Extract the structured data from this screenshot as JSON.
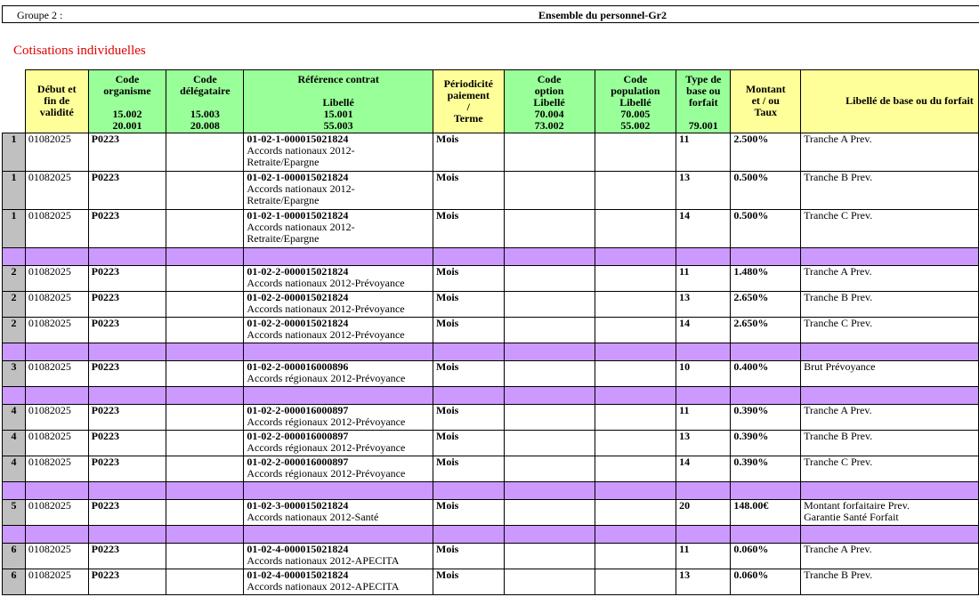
{
  "group": {
    "label": "Groupe 2 :",
    "value": "Ensemble du personnel-Gr2"
  },
  "section_title": "Cotisations individuelles",
  "headers": {
    "debut": "Début et\nfin de\nvalidité",
    "organisme": "Code\norganisme\n\n15.002\n20.001",
    "delegataire": "Code\ndélégataire\n\n15.003\n20.008",
    "reference": "Référence contrat\n\nLibellé\n15.001\n55.003",
    "periodicite": "Périodicité\npaiement\n/\nTerme",
    "option": "Code\noption\nLibellé\n70.004\n73.002",
    "population": "Code\npopulation\nLibellé\n70.005\n55.002",
    "type": "Type de\nbase ou\nforfait\n\n79.001",
    "montant": "Montant\net / ou\nTaux",
    "libelle": "Libellé de base ou du forfait"
  },
  "colors": {
    "yellow": "#ffff99",
    "green": "#99ff99",
    "separator": "#cc99ff",
    "index": "#c0c0c0",
    "section": "#e00000"
  },
  "rows": [
    {
      "idx": "1",
      "date": "01082025",
      "org": "P0223",
      "ref": "01-02-1-000015021824",
      "lib": "Accords nationaux 2012-\nRetraite/Epargne",
      "per": "Mois",
      "type": "11",
      "montant": "2.500%",
      "base": "Tranche A Prev.",
      "h": 3
    },
    {
      "idx": "1",
      "date": "01082025",
      "org": "P0223",
      "ref": "01-02-1-000015021824",
      "lib": "Accords nationaux 2012-\nRetraite/Epargne",
      "per": "Mois",
      "type": "13",
      "montant": "0.500%",
      "base": "Tranche B Prev.",
      "h": 3
    },
    {
      "idx": "1",
      "date": "01082025",
      "org": "P0223",
      "ref": "01-02-1-000015021824",
      "lib": "Accords nationaux 2012-\nRetraite/Epargne",
      "per": "Mois",
      "type": "14",
      "montant": "0.500%",
      "base": "Tranche C Prev.",
      "h": 3
    },
    {
      "sep": true
    },
    {
      "idx": "2",
      "date": "01082025",
      "org": "P0223",
      "ref": "01-02-2-000015021824",
      "lib": "Accords nationaux 2012-Prévoyance",
      "per": "Mois",
      "type": "11",
      "montant": "1.480%",
      "base": "Tranche A Prev.",
      "h": 2
    },
    {
      "idx": "2",
      "date": "01082025",
      "org": "P0223",
      "ref": "01-02-2-000015021824",
      "lib": "Accords nationaux 2012-Prévoyance",
      "per": "Mois",
      "type": "13",
      "montant": "2.650%",
      "base": "Tranche B Prev.",
      "h": 2
    },
    {
      "idx": "2",
      "date": "01082025",
      "org": "P0223",
      "ref": "01-02-2-000015021824",
      "lib": "Accords nationaux 2012-Prévoyance",
      "per": "Mois",
      "type": "14",
      "montant": "2.650%",
      "base": "Tranche C Prev.",
      "h": 2
    },
    {
      "sep": true
    },
    {
      "idx": "3",
      "date": "01082025",
      "org": "P0223",
      "ref": "01-02-2-000016000896",
      "lib": "Accords régionaux 2012-Prévoyance",
      "per": "Mois",
      "type": "10",
      "montant": "0.400%",
      "base": "Brut Prévoyance",
      "h": 2
    },
    {
      "sep": true
    },
    {
      "idx": "4",
      "date": "01082025",
      "org": "P0223",
      "ref": "01-02-2-000016000897",
      "lib": "Accords régionaux 2012-Prévoyance",
      "per": "Mois",
      "type": "11",
      "montant": "0.390%",
      "base": "Tranche A Prev.",
      "h": 2
    },
    {
      "idx": "4",
      "date": "01082025",
      "org": "P0223",
      "ref": "01-02-2-000016000897",
      "lib": "Accords régionaux 2012-Prévoyance",
      "per": "Mois",
      "type": "13",
      "montant": "0.390%",
      "base": "Tranche B Prev.",
      "h": 2
    },
    {
      "idx": "4",
      "date": "01082025",
      "org": "P0223",
      "ref": "01-02-2-000016000897",
      "lib": "Accords régionaux 2012-Prévoyance",
      "per": "Mois",
      "type": "14",
      "montant": "0.390%",
      "base": "Tranche C Prev.",
      "h": 2
    },
    {
      "sep": true
    },
    {
      "idx": "5",
      "date": "01082025",
      "org": "P0223",
      "ref": "01-02-3-000015021824",
      "lib": "Accords nationaux 2012-Santé",
      "per": "Mois",
      "type": "20",
      "montant": "148.00€",
      "base": "Montant forfaitaire Prev.\nGarantie Santé Forfait",
      "h": 2
    },
    {
      "sep": true
    },
    {
      "idx": "6",
      "date": "01082025",
      "org": "P0223",
      "ref": "01-02-4-000015021824",
      "lib": "Accords nationaux 2012-APECITA",
      "per": "Mois",
      "type": "11",
      "montant": "0.060%",
      "base": "Tranche A Prev.",
      "h": 2
    },
    {
      "idx": "6",
      "date": "01082025",
      "org": "P0223",
      "ref": "01-02-4-000015021824",
      "lib": "Accords nationaux 2012-APECITA",
      "per": "Mois",
      "type": "13",
      "montant": "0.060%",
      "base": "Tranche B Prev.",
      "h": 2
    }
  ]
}
